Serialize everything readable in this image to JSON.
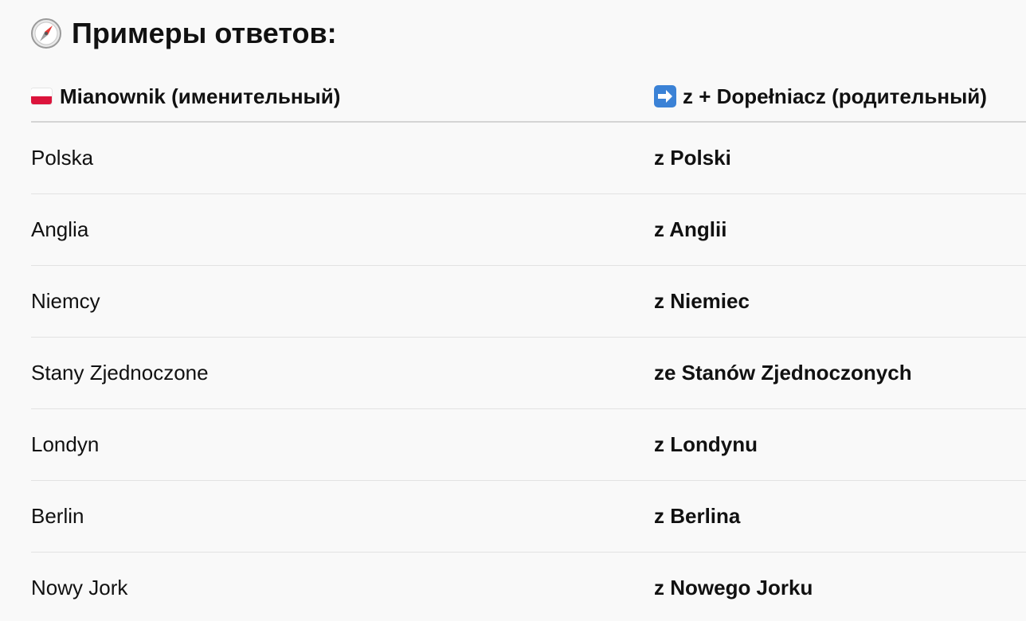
{
  "header": {
    "title": "Примеры ответов:",
    "icon": "compass-icon"
  },
  "table": {
    "columns": [
      {
        "label": "Mianownik (именительный)",
        "icon": "poland-flag-icon"
      },
      {
        "label": "z + Dopełniacz (родительный)",
        "icon": "right-arrow-icon"
      }
    ],
    "rows": [
      {
        "nominative": "Polska",
        "genitive": "z Polski"
      },
      {
        "nominative": "Anglia",
        "genitive": "z Anglii"
      },
      {
        "nominative": "Niemcy",
        "genitive": "z Niemiec"
      },
      {
        "nominative": "Stany Zjednoczone",
        "genitive": "ze Stanów Zjednoczonych"
      },
      {
        "nominative": "Londyn",
        "genitive": "z Londynu"
      },
      {
        "nominative": "Berlin",
        "genitive": "z Berlina"
      },
      {
        "nominative": "Nowy Jork",
        "genitive": "z Nowego Jorku"
      }
    ]
  },
  "colors": {
    "background": "#f9f9f9",
    "text": "#111111",
    "header_divider": "#d4d4d4",
    "row_divider": "#e3e3e3",
    "flag_red": "#dc143c",
    "arrow_blue": "#3b82d6"
  }
}
